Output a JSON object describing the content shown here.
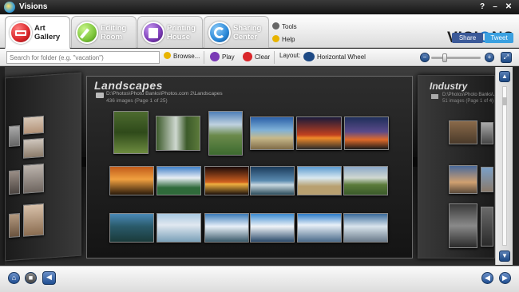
{
  "window": {
    "title": "Visions",
    "buttons": [
      "?",
      "–",
      "✕"
    ]
  },
  "tabs": [
    {
      "label_line1": "Art",
      "label_line2": "Gallery",
      "color": "#d9262a",
      "active": true
    },
    {
      "label_line1": "Editing",
      "label_line2": "Room",
      "color": "#7cc43a",
      "active": false
    },
    {
      "label_line1": "Printing",
      "label_line2": "House",
      "color": "#7a3ab5",
      "active": false
    },
    {
      "label_line1": "Sharing",
      "label_line2": "Center",
      "color": "#2a88d8",
      "active": false
    }
  ],
  "side_links": {
    "tools": "Tools",
    "help": "Help"
  },
  "brand": {
    "logo_left": "VISI",
    "logo_o": "O",
    "logo_right": "NS",
    "share": "Share",
    "tweet": "Tweet"
  },
  "toolbar": {
    "search_placeholder": "Search for folder (e.g. \"vacation\")",
    "browse": "Browse...",
    "play": "Play",
    "clear": "Clear",
    "layout_label": "Layout:",
    "layout_value": "Horizontal Wheel"
  },
  "main_album": {
    "title": "Landscapes",
    "path": "D:\\Photos\\Photo Banks\\Photos.com 2\\Landscapes",
    "count": "436 images (Page 1 of 25)"
  },
  "right_album": {
    "title": "Industry",
    "path": "D:\\Photos\\Photo Banks\\...",
    "count": "51 images (Page 1 of 4)"
  },
  "colors": {
    "accent": "#1e78c8",
    "stage": "#1a1a1a"
  }
}
